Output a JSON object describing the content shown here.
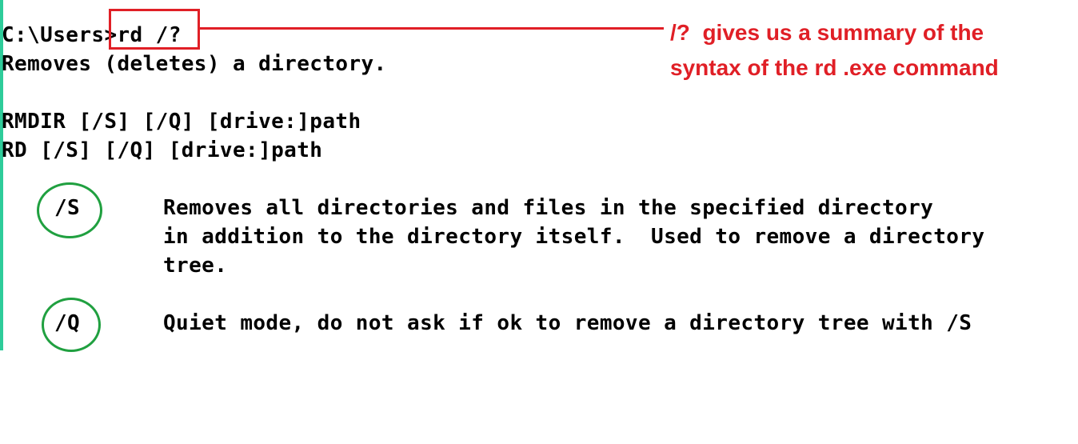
{
  "terminal": {
    "prompt_path": "C:\\Users",
    "prompt_gt": ">",
    "command": "rd /?",
    "description": "Removes (deletes) a directory.",
    "syntax_rmdir": "RMDIR [/S] [/Q] [drive:]path",
    "syntax_rd": "RD [/S] [/Q] [drive:]path",
    "options": [
      {
        "flag": "/S",
        "lines": [
          "Removes all directories and files in the specified directory",
          "in addition to the directory itself.  Used to remove a directory",
          "tree."
        ]
      },
      {
        "flag": "/Q",
        "lines": [
          "Quiet mode, do not ask if ok to remove a directory tree with /S"
        ]
      }
    ]
  },
  "annotation": {
    "line1": "/?  gives us a summary of the",
    "line2": "syntax of the rd .exe command"
  },
  "colors": {
    "annotation_red": "#e01f26",
    "circle_green": "#20a040",
    "left_bar": "#2ecc9a",
    "text": "#000000",
    "background": "#ffffff"
  }
}
